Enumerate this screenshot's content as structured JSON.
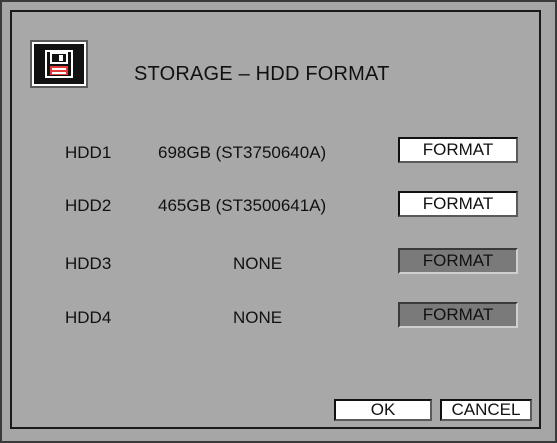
{
  "dialog": {
    "title": "STORAGE – HDD FORMAT",
    "icon": "floppy-disk-icon"
  },
  "drives": [
    {
      "label": "HDD1",
      "value": "698GB (ST3750640A)",
      "button": "FORMAT",
      "enabled": true
    },
    {
      "label": "HDD2",
      "value": "465GB (ST3500641A)",
      "button": "FORMAT",
      "enabled": true
    },
    {
      "label": "HDD3",
      "value": "NONE",
      "button": "FORMAT",
      "enabled": false
    },
    {
      "label": "HDD4",
      "value": "NONE",
      "button": "FORMAT",
      "enabled": false
    }
  ],
  "buttons": {
    "ok": "OK",
    "cancel": "CANCEL"
  }
}
